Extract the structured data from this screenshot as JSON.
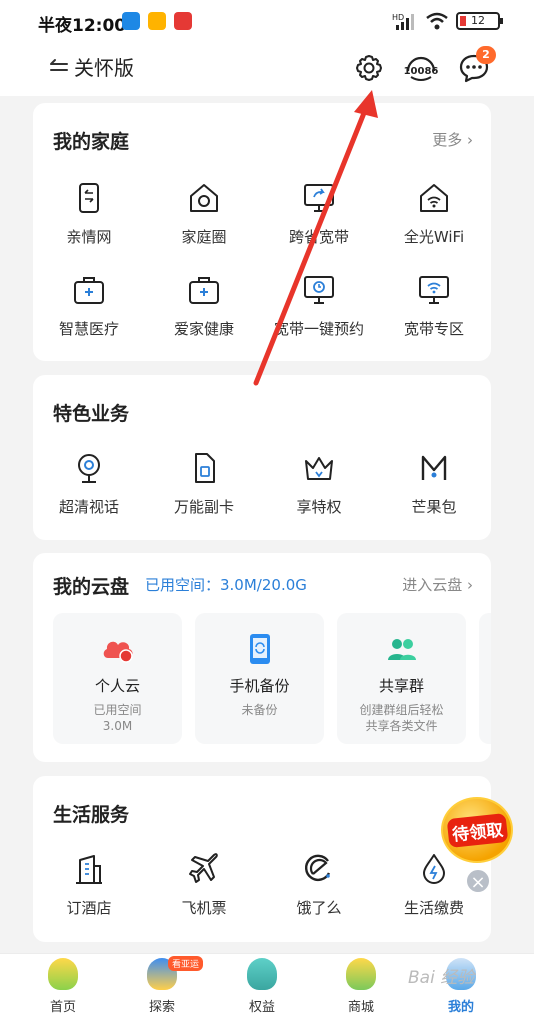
{
  "status": {
    "time": "半夜12:00",
    "battery": "12"
  },
  "header": {
    "care_label": "关怀版",
    "service_label": "10086",
    "message_badge": "2"
  },
  "family": {
    "title": "我的家庭",
    "more": "更多",
    "items": [
      {
        "label": "亲情网",
        "icon": "phone-family-icon"
      },
      {
        "label": "家庭圈",
        "icon": "home-circle-icon"
      },
      {
        "label": "跨省宽带",
        "icon": "monitor-share-icon"
      },
      {
        "label": "全光WiFi",
        "icon": "home-wifi-icon"
      },
      {
        "label": "智慧医疗",
        "icon": "medical-kit-icon"
      },
      {
        "label": "爱家健康",
        "icon": "health-kit-icon"
      },
      {
        "label": "宽带一键预约",
        "icon": "monitor-clock-icon"
      },
      {
        "label": "宽带专区",
        "icon": "monitor-wifi-icon"
      }
    ]
  },
  "featured": {
    "title": "特色业务",
    "items": [
      {
        "label": "超清视话",
        "icon": "webcam-icon"
      },
      {
        "label": "万能副卡",
        "icon": "sim-card-icon"
      },
      {
        "label": "享特权",
        "icon": "crown-icon"
      },
      {
        "label": "芒果包",
        "icon": "mango-logo-icon"
      }
    ]
  },
  "cloud": {
    "title": "我的云盘",
    "used": "已用空间：3.0M/20.0G",
    "enter": "进入云盘",
    "tiles": [
      {
        "title": "个人云",
        "line1": "已用空间",
        "line2": "3.0M"
      },
      {
        "title": "手机备份",
        "line1": "未备份",
        "line2": ""
      },
      {
        "title": "共享群",
        "line1": "创建群组后轻松",
        "line2": "共享各类文件"
      }
    ]
  },
  "life": {
    "title": "生活服务",
    "items": [
      {
        "label": "订酒店",
        "icon": "hotel-icon"
      },
      {
        "label": "飞机票",
        "icon": "airplane-icon"
      },
      {
        "label": "饿了么",
        "icon": "eleme-icon"
      },
      {
        "label": "生活缴费",
        "icon": "water-drop-icon"
      }
    ]
  },
  "float": {
    "gift_label": "待领取"
  },
  "tabs": [
    {
      "label": "首页"
    },
    {
      "label": "探索",
      "badge": "看亚运"
    },
    {
      "label": "权益"
    },
    {
      "label": "商城"
    },
    {
      "label": "我的"
    }
  ],
  "watermark": "Bai 经验",
  "colors": {
    "accent": "#2b7fd8",
    "annotation_arrow": "#e8352b",
    "badge": "#ff6a2c"
  }
}
